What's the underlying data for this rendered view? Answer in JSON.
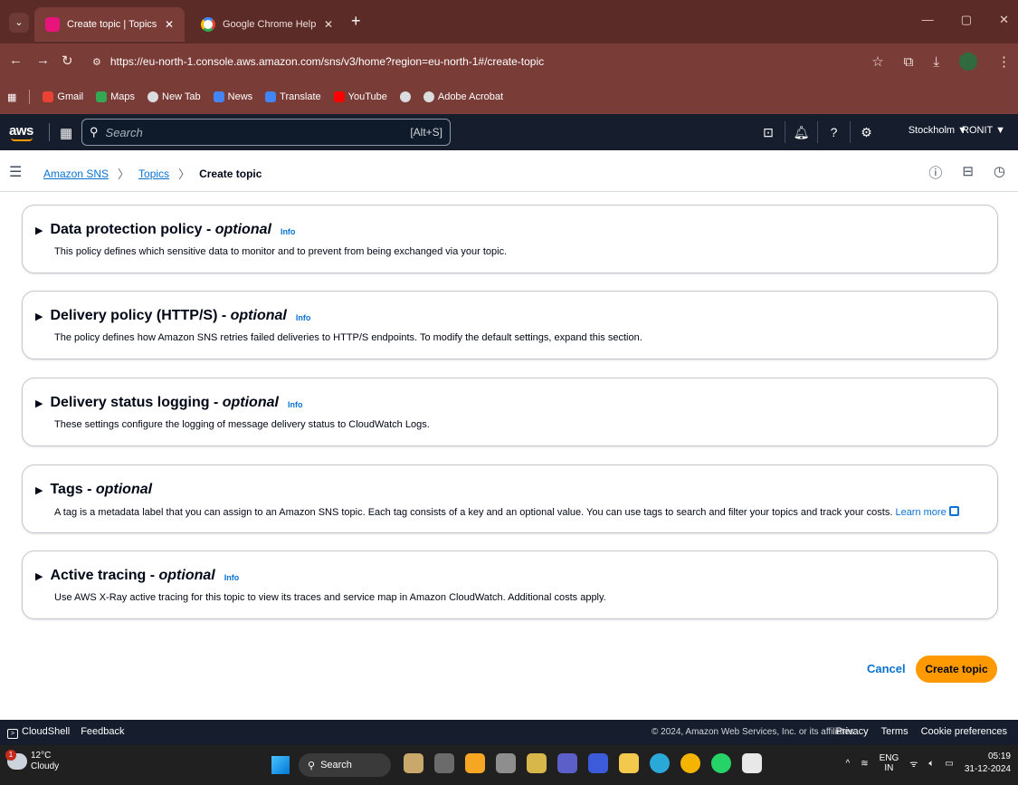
{
  "browser": {
    "tabs": [
      {
        "title": "Create topic | Topics | Simple N",
        "active": true
      },
      {
        "title": "Google Chrome Help",
        "active": false
      }
    ],
    "new_tab": "+",
    "url": "https://eu-north-1.console.aws.amazon.com/sns/v3/home?region=eu-north-1#/create-topic",
    "bookmarks": [
      "Gmail",
      "Maps",
      "New Tab",
      "News",
      "Translate",
      "YouTube",
      "Adobe Acrobat"
    ]
  },
  "aws_header": {
    "logo": "aws",
    "search_placeholder": "Search",
    "search_shortcut": "[Alt+S]",
    "region": "Stockholm ▼",
    "account": "RONIT ▼"
  },
  "breadcrumb": {
    "items": [
      "Amazon SNS",
      "Topics"
    ],
    "current": "Create topic"
  },
  "sections": [
    {
      "title": "Data protection policy - ",
      "optional": "optional",
      "info": "Info",
      "description": "This policy defines which sensitive data to monitor and to prevent from being exchanged via your topic."
    },
    {
      "title": "Delivery policy (HTTP/S) - ",
      "optional": "optional",
      "info": "Info",
      "description": "The policy defines how Amazon SNS retries failed deliveries to HTTP/S endpoints. To modify the default settings, expand this section."
    },
    {
      "title": "Delivery status logging - ",
      "optional": "optional",
      "info": "Info",
      "description": "These settings configure the logging of message delivery status to CloudWatch Logs."
    },
    {
      "title": "Tags - ",
      "optional": "optional",
      "info": "",
      "description": "A tag is a metadata label that you can assign to an Amazon SNS topic. Each tag consists of a key and an optional value. You can use tags to search and filter your topics and track your costs.",
      "learn_more": "Learn more"
    },
    {
      "title": "Active tracing - ",
      "optional": "optional",
      "info": "Info",
      "description": "Use AWS X-Ray active tracing for this topic to view its traces and service map in Amazon CloudWatch. Additional costs apply."
    }
  ],
  "actions": {
    "cancel": "Cancel",
    "create": "Create topic"
  },
  "footer": {
    "cloudshell": "CloudShell",
    "feedback": "Feedback",
    "copyright": "© 2024, Amazon Web Services, Inc. or its affiliates.",
    "privacy": "Privacy",
    "terms": "Terms",
    "cookies": "Cookie preferences"
  },
  "taskbar": {
    "weather_temp": "12°C",
    "weather_desc": "Cloudy",
    "weather_badge": "1",
    "search": "Search",
    "lang_top": "ENG",
    "lang_bottom": "IN",
    "time": "05:19",
    "date": "31-12-2024"
  },
  "colors": {
    "link": "#0972d3",
    "primary_button": "#ff9900",
    "aws_header": "#161e2d",
    "browser_frame": "#7a3c36"
  }
}
